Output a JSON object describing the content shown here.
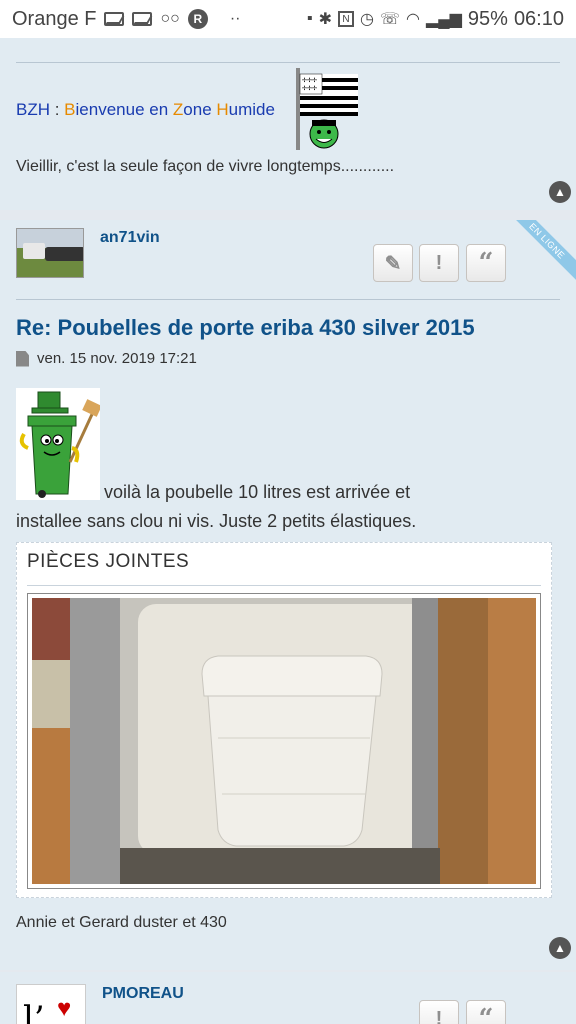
{
  "status_bar": {
    "carrier": "Orange F",
    "battery": "95%",
    "time": "06:10"
  },
  "post1": {
    "sig_bzh": "BZH",
    "sig_colon": " : ",
    "sig_b": "B",
    "sig_ienvenue": "ienvenue en ",
    "sig_z": "Z",
    "sig_one": "one ",
    "sig_h": "H",
    "sig_umide": "umide",
    "sig_quote": "Vieillir, c'est la seule façon de vivre longtemps............"
  },
  "post2": {
    "author": "an71vin",
    "online_badge": "EN LIGNE",
    "title": "Re: Poubelles de porte eriba 430 silver 2015",
    "date": "ven. 15 nov. 2019 17:21",
    "text_line1": "voilà la poubelle 10 litres est arrivée et",
    "text_line2": "installee sans clou ni vis. Juste 2 petits élastiques.",
    "attachments_title": "PIÈCES JOINTES",
    "signature": "Annie et Gerard duster et 430"
  },
  "post3": {
    "author": "PMOREAU",
    "avatar_text": "l’"
  },
  "colors": {
    "link": "#105289",
    "panel": "#e1ebf2",
    "signature_blue": "#1a3cb0",
    "signature_orange": "#e68a00"
  }
}
